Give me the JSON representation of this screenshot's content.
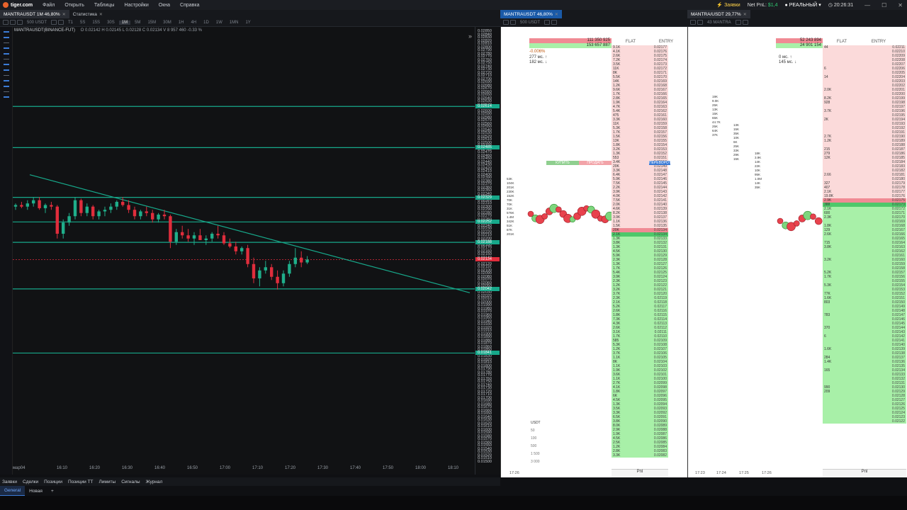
{
  "app": {
    "logo": "tiger.com",
    "menu": [
      "Файл",
      "Открыть",
      "Таблицы",
      "Настройки",
      "Окна",
      "Справка"
    ]
  },
  "topright": {
    "alerts": "Заявки",
    "pnl_label": "Net PnL:",
    "pnl_value": "$1,4",
    "mode": "РЕАЛЬНЫЙ",
    "clock": "20:26:31"
  },
  "colors": {
    "accent": "#3b7bd6",
    "up": "#17a88a",
    "down": "#e02d3c",
    "ask": "#fbdada",
    "bid": "#a8f0a8"
  },
  "left_window": {
    "tabs": [
      {
        "label": "MANTRAUSDT 1M 46,80%"
      },
      {
        "label": "Статистика"
      }
    ],
    "toolbar": {
      "qty": "500 USDT",
      "timeframes": [
        "T1",
        "5S",
        "15S",
        "30S",
        "1M",
        "5M",
        "15M",
        "30M",
        "1H",
        "4H",
        "1D",
        "1W",
        "1MN",
        "1Y"
      ],
      "active": "1M"
    },
    "ohlc": {
      "symbol": "MANTRAUSDT(BINANCE-FUT)",
      "o": "O 0.02142",
      "h": "H 0.02145",
      "l": "L 0.02128",
      "c": "C 0.02134",
      "v": "V 8 957 460",
      "chg": "-0.33 %"
    },
    "price_ticks": [
      "0.02850",
      "0.02840",
      "0.02830",
      "0.02820",
      "0.02810",
      "0.02800",
      "0.02790",
      "0.02780",
      "0.02770",
      "0.02760",
      "0.02750",
      "0.02740",
      "0.02730",
      "0.02720",
      "0.02710",
      "0.02700",
      "0.02690",
      "0.02680",
      "0.02670",
      "0.02660",
      "0.02650",
      "0.02640",
      "0.02630",
      "0.02620",
      "0.02610",
      "0.02600",
      "0.02590",
      "0.02580",
      "0.02570",
      "0.02560",
      "0.02550",
      "0.02540",
      "0.02530",
      "0.02520",
      "0.02510",
      "0.02500",
      "0.02490",
      "0.02480",
      "0.02470",
      "0.02460",
      "0.02450",
      "0.02440",
      "0.02430",
      "0.02420",
      "0.02410",
      "0.02400",
      "0.02390",
      "0.02380",
      "0.02370",
      "0.02360",
      "0.02350",
      "0.02340",
      "0.02330",
      "0.02320",
      "0.02310",
      "0.02300",
      "0.02290",
      "0.02280",
      "0.02270",
      "0.02260",
      "0.02250",
      "0.02240",
      "0.02230",
      "0.02220",
      "0.02210",
      "0.02200",
      "0.02190",
      "0.02180",
      "0.02170",
      "0.02160",
      "0.02150",
      "0.02140",
      "0.02130",
      "0.02120",
      "0.02110",
      "0.02100",
      "0.02090",
      "0.02080",
      "0.02070",
      "0.02060",
      "0.02050",
      "0.02040",
      "0.02030",
      "0.02020",
      "0.02010",
      "0.02000",
      "0.01990",
      "0.01980",
      "0.01970",
      "0.01960",
      "0.01950",
      "0.01940",
      "0.01930",
      "0.01920",
      "0.01910",
      "0.01900",
      "0.01890",
      "0.01880",
      "0.01870",
      "0.01860",
      "0.01850",
      "0.01840",
      "0.01830",
      "0.01820",
      "0.01810",
      "0.01800",
      "0.01790",
      "0.01780",
      "0.01770",
      "0.01760",
      "0.01750",
      "0.01740",
      "0.01730",
      "0.01720",
      "0.01710",
      "0.01700",
      "0.01690",
      "0.01680",
      "0.01670",
      "0.01660",
      "0.01650",
      "0.01640",
      "0.01630",
      "0.01620",
      "0.01610",
      "0.01600",
      "0.01590",
      "0.01580",
      "0.01570",
      "0.01560",
      "0.01550",
      "0.01540",
      "0.01530",
      "0.01520",
      "0.01510",
      "0.01500"
    ],
    "levels": [
      "0.02614",
      "0.02485",
      "0.02329",
      "0.02252",
      "0.02188",
      "0.02042",
      "0.01841"
    ],
    "current_price": "0.02134",
    "time_ticks": [
      "мар04",
      "16:10",
      "16:20",
      "16:30",
      "16:40",
      "16:50",
      "17:00",
      "17:10",
      "17:20",
      "17:30",
      "17:40",
      "17:50",
      "18:00",
      "18:10"
    ],
    "bottom_tabs": [
      "Заявки",
      "Сделки",
      "Позиции",
      "Позиции ТТ",
      "Лимиты",
      "Сигналы",
      "Журнал"
    ]
  },
  "chart_data": {
    "type": "candlestick",
    "x_start": "16:00",
    "interval": "1m",
    "ylim": [
      0.015,
      0.0285
    ],
    "ohlc": [
      [
        0.023,
        0.0231,
        0.0229,
        0.02305
      ],
      [
        0.02305,
        0.02315,
        0.02295,
        0.023
      ],
      [
        0.023,
        0.0232,
        0.0229,
        0.0231
      ],
      [
        0.0231,
        0.0233,
        0.023,
        0.0232
      ],
      [
        0.0232,
        0.0233,
        0.0229,
        0.02295
      ],
      [
        0.02295,
        0.0231,
        0.0228,
        0.02305
      ],
      [
        0.02305,
        0.02315,
        0.0229,
        0.023
      ],
      [
        0.023,
        0.02305,
        0.022,
        0.02215
      ],
      [
        0.02215,
        0.0226,
        0.022,
        0.0225
      ],
      [
        0.0225,
        0.0228,
        0.0224,
        0.0227
      ],
      [
        0.0227,
        0.0233,
        0.0226,
        0.0232
      ],
      [
        0.0232,
        0.02325,
        0.0227,
        0.0228
      ],
      [
        0.0228,
        0.0231,
        0.0227,
        0.023
      ],
      [
        0.023,
        0.02305,
        0.0226,
        0.0227
      ],
      [
        0.0227,
        0.0229,
        0.0226,
        0.02285
      ],
      [
        0.02285,
        0.023,
        0.0227,
        0.0229
      ],
      [
        0.0229,
        0.0231,
        0.0228,
        0.023
      ],
      [
        0.023,
        0.0232,
        0.0229,
        0.02315
      ],
      [
        0.02315,
        0.0233,
        0.023,
        0.02305
      ],
      [
        0.02305,
        0.0232,
        0.0228,
        0.0229
      ],
      [
        0.0229,
        0.023,
        0.0226,
        0.0227
      ],
      [
        0.0227,
        0.0229,
        0.0226,
        0.02285
      ],
      [
        0.02285,
        0.023,
        0.0227,
        0.0228
      ],
      [
        0.0228,
        0.0229,
        0.0225,
        0.0226
      ],
      [
        0.0226,
        0.0228,
        0.0225,
        0.02275
      ],
      [
        0.02275,
        0.0229,
        0.0226,
        0.0227
      ],
      [
        0.0227,
        0.02275,
        0.0217,
        0.0219
      ],
      [
        0.0219,
        0.0223,
        0.0218,
        0.0222
      ],
      [
        0.0222,
        0.0224,
        0.022,
        0.0221
      ],
      [
        0.0221,
        0.0223,
        0.0219,
        0.022
      ],
      [
        0.022,
        0.0222,
        0.0218,
        0.0221
      ],
      [
        0.0221,
        0.0223,
        0.022,
        0.02195
      ],
      [
        0.02195,
        0.0221,
        0.0218,
        0.022
      ],
      [
        0.022,
        0.0222,
        0.0219,
        0.02215
      ],
      [
        0.02215,
        0.0224,
        0.022,
        0.0221
      ],
      [
        0.0221,
        0.0222,
        0.0218,
        0.02185
      ],
      [
        0.02185,
        0.022,
        0.0217,
        0.02175
      ],
      [
        0.02175,
        0.0219,
        0.0215,
        0.0216
      ],
      [
        0.0216,
        0.02175,
        0.0215,
        0.0217
      ],
      [
        0.0217,
        0.0218,
        0.0211,
        0.0212
      ],
      [
        0.0212,
        0.0214,
        0.0206,
        0.02075
      ],
      [
        0.02075,
        0.0211,
        0.0205,
        0.021
      ],
      [
        0.021,
        0.0213,
        0.0209,
        0.0211
      ],
      [
        0.0211,
        0.0212,
        0.0207,
        0.0208
      ],
      [
        0.0208,
        0.021,
        0.0204,
        0.0206
      ],
      [
        0.0206,
        0.021,
        0.0205,
        0.0209
      ],
      [
        0.0209,
        0.0213,
        0.0208,
        0.0212
      ],
      [
        0.0212,
        0.0217,
        0.0211,
        0.0214
      ],
      [
        0.0214,
        0.0216,
        0.0211,
        0.02125
      ],
      [
        0.02125,
        0.02145,
        0.0212,
        0.02134
      ]
    ],
    "trend_line": {
      "from": [
        "16:00",
        0.024
      ],
      "to": [
        "18:15",
        0.0203
      ]
    },
    "horizontal_lines": [
      0.02614,
      0.02485,
      0.02329,
      0.02252,
      0.02188,
      0.02042,
      0.01841
    ],
    "current_price": 0.02134
  },
  "dom1": {
    "tab": "MANTRAUSDT 46,80%",
    "qty": "500 USDT",
    "headers": {
      "flat": "FLAT",
      "entry": "ENTRY"
    },
    "pbox": {
      "a": "111 350 925",
      "b": "153 657 887"
    },
    "ping": {
      "pct": "-0.006%",
      "ms1": "277 мс. ↑",
      "ms2": "182 мс. ↓"
    },
    "buy": "КУПИТЬ",
    "sell": "ПРОДАТЬ",
    "reverse": "ПЕРЕВОРОТ",
    "usdt": {
      "label": "USDT",
      "opts": [
        "50",
        "100",
        "500",
        "1 500",
        "3 000"
      ]
    },
    "times": [
      "17:26"
    ],
    "pnl": "Pnl",
    "ask_prices_start": 0.02177,
    "bid_prices_start": 0.02134,
    "ask_vols": [
      "9.1K",
      "4.1K",
      "2.6K",
      "7.2K",
      "3.5K",
      "11K",
      "8K",
      "5.5K",
      "14K",
      "1.2K",
      "9.6K",
      "1.7K",
      "2.8K",
      "1.9K",
      "4.7K",
      "5.4K",
      "475",
      "3.3K",
      "11K",
      "5.3K",
      "1.7K",
      "1.5K",
      "13K",
      "1.8K",
      "3.2K",
      "1.3K",
      "553",
      "3.4K",
      "20K",
      "3.3K",
      "6.4K",
      "5.9K",
      "7.5K",
      "2.2K",
      "3.9K",
      "4.0K",
      "7.5K",
      "2.0K",
      "4.6K",
      "8.2K",
      "3.9K",
      "1.1K",
      "1.5K",
      "20K"
    ],
    "bid_vols": [
      "2.1K",
      "1.3K",
      "3.8K",
      "1.3K",
      "4.5K",
      "5.9K",
      "2.3K",
      "1.3K",
      "1.7K",
      "5.4K",
      "3.9K",
      "2.3K",
      "1.2K",
      "3.2K",
      "3.7K",
      "2.3K",
      "2.1K",
      "5.2K",
      "2.6K",
      "1.8K",
      "7.3K",
      "4.3K",
      "2.6K",
      "3.1K",
      "1.7K",
      "585",
      "5.3K",
      "1.2K",
      "3.7K",
      "1.1K",
      "8K",
      "1.1K",
      "1.9K",
      "3.6K",
      "1.1K",
      "2.7K",
      "4.1K",
      "1.8K",
      "6K",
      "4.5K",
      "1.3K",
      "3.5K",
      "3.3K",
      "6.5K",
      "3.8K",
      "8.0K",
      "2.9K",
      "1.9K",
      "4.5K",
      "2.5K",
      "1.2K",
      "2.8K",
      "3.3K"
    ],
    "left_vols": [
      "53K",
      "104K",
      "201K",
      "230K",
      "152K",
      "70K",
      "70K",
      "31K",
      "576K",
      "1.4M",
      "342K",
      "51K",
      "87K",
      "201K"
    ]
  },
  "dom2": {
    "tab": "MANTRA/USDT 29,77%",
    "qty": "43 MANTRA",
    "headers": {
      "flat": "FLAT",
      "entry": "ENTRY"
    },
    "pbox": {
      "a": "52 243 894",
      "b": "24 901 154"
    },
    "ping": {
      "ms1": "0 мс. ↑",
      "ms2": "145 мс. ↓"
    },
    "times": [
      "17:23",
      "17:24",
      "17:25",
      "17:26"
    ],
    "pnl": "Pnl",
    "ask_prices_start": 0.02211,
    "bid_prices_start": 0.02173,
    "ask_vols": [
      "44",
      "",
      "",
      "",
      "",
      "6",
      "",
      "14",
      "",
      "",
      "2.0K",
      "",
      "8.2K",
      "928",
      "",
      "3.7K",
      "",
      "2K",
      "",
      "",
      "",
      "2.7K",
      "1.2K",
      "",
      "215",
      "279",
      "12K",
      "",
      "",
      "",
      "2.66",
      "",
      "327",
      "407",
      "2.1K",
      "19.8K",
      "2.9K"
    ],
    "bid_vols": [
      "388",
      "2.1K",
      "600",
      "2.3K",
      "",
      "1.8K",
      "129",
      "2.6K",
      "",
      "715",
      "3.8K",
      "",
      "",
      "3.2K",
      "",
      "",
      "5.2K",
      "1.7K",
      "",
      "5.3K",
      "",
      "77K",
      "1.6K",
      "803",
      "",
      "",
      "783",
      "",
      "",
      "370",
      "",
      "6",
      "",
      "",
      "1.6K",
      "",
      "284",
      "1.4K",
      "",
      "165",
      "",
      "",
      "",
      "990",
      "209",
      "",
      "",
      "",
      "",
      "",
      "",
      ""
    ],
    "left_vols": [
      "19K",
      "13K",
      "18K",
      "9.0K",
      "15K",
      "3.9K",
      "25K",
      "35K",
      "14K",
      "13K",
      "10K",
      "22K",
      "15K",
      "6K",
      "10K",
      "65K",
      "25K",
      "95K",
      "44.7K",
      "33K",
      "1.0M",
      "25K",
      "29K",
      "14K",
      "64K",
      "15K",
      "35K",
      "37K"
    ]
  }
}
